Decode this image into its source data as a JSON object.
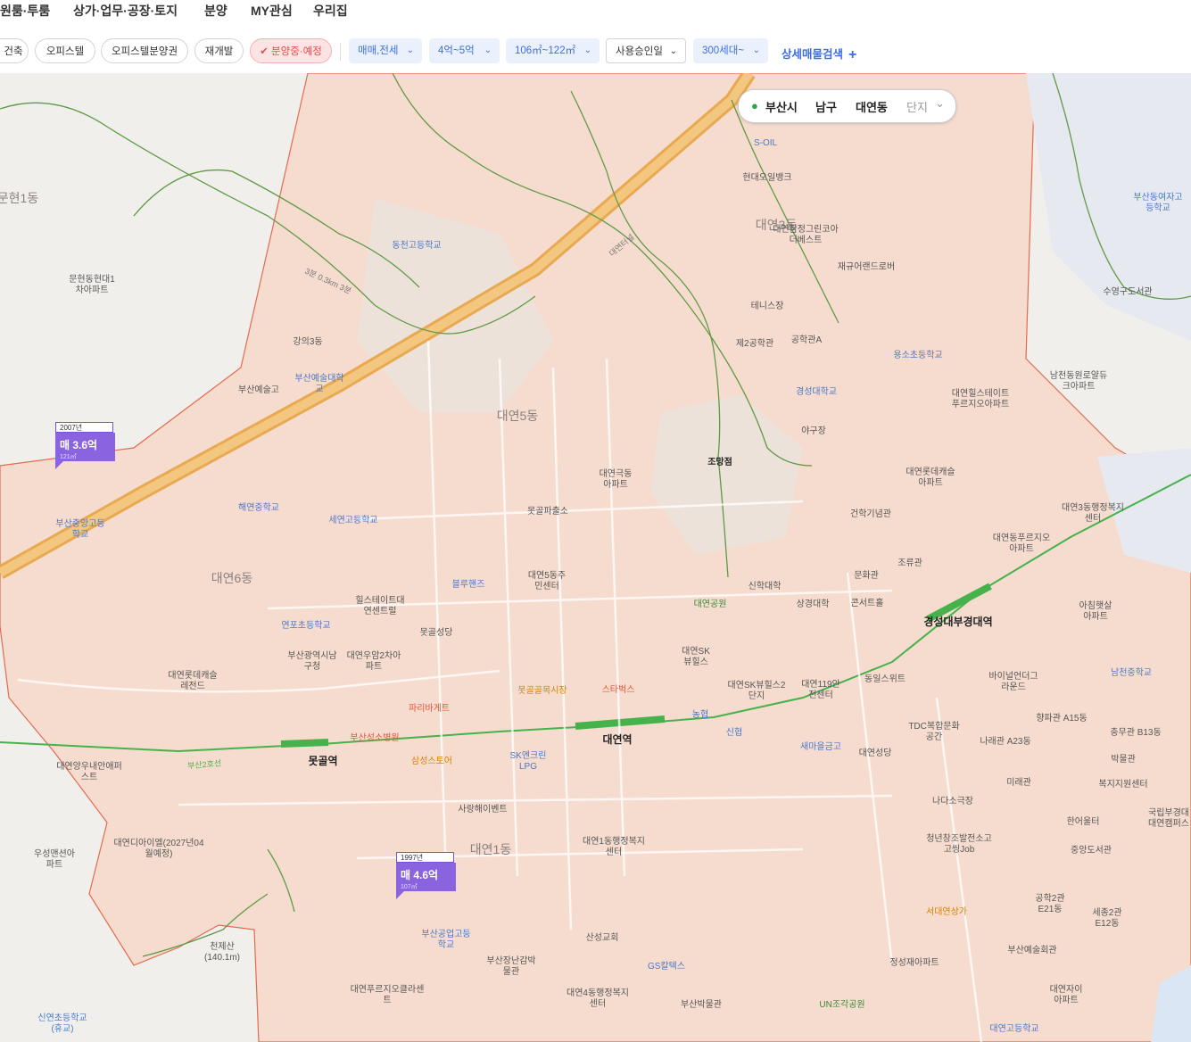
{
  "topnav": [
    "원룸·투룸",
    "상가·업무·공장·토지",
    "분양",
    "MY관심",
    "우리집"
  ],
  "filters": {
    "chips": [
      {
        "label": "건축",
        "active": false
      },
      {
        "label": "오피스텔",
        "active": false
      },
      {
        "label": "오피스텔분양권",
        "active": false
      },
      {
        "label": "재개발",
        "active": false
      },
      {
        "label": "✔ 분양중·예정",
        "active": true
      }
    ],
    "dropdowns": [
      {
        "label": "매매,전세",
        "style": "blue"
      },
      {
        "label": "4억~5억",
        "style": "blue"
      },
      {
        "label": "106㎡~122㎡",
        "style": "blue"
      },
      {
        "label": "사용승인일",
        "style": "white"
      },
      {
        "label": "300세대~",
        "style": "blue"
      }
    ],
    "detail_search": "상세매물검색",
    "plus": "+"
  },
  "location": {
    "city": "부산시",
    "district": "남구",
    "dong": "대연동",
    "type": "단지"
  },
  "icons": {
    "pin": "location-pin-icon",
    "chevron": "chevron-down-icon"
  },
  "colors": {
    "district_fill": "#f6dccf",
    "district_border": "#e46a4e",
    "trail": "#4f8f3a",
    "expressway": "#e9a950",
    "subway": "#46b24b",
    "card": "#8a63e0",
    "active_chip": "#e5504a",
    "dropdown_text": "#3d6fdc"
  },
  "listings": [
    {
      "year": "2007년",
      "price": "매 3.6억",
      "size": "121㎡"
    },
    {
      "year": "1997년",
      "price": "매 4.6억",
      "size": "107㎡"
    }
  ],
  "stations": [
    "못골역",
    "대연역",
    "경성대부경대역"
  ],
  "areas": [
    "문현1동",
    "대연3동",
    "대연5동",
    "대연6동",
    "대연1동"
  ],
  "roads": [
    "대연터널",
    "부산2호선",
    "3분 0.3km 3분"
  ],
  "place_labels": {
    "schools": [
      "동천고등학교",
      "부산중앙고등학교",
      "부산예술대학교",
      "부산예술고",
      "해연중학교",
      "세연고등학교",
      "연포초등학교",
      "용소초등학교",
      "경성대학교",
      "부산동여자고등학교",
      "부산공업고등학교",
      "신연초등학교(휴교)",
      "대연고등학교",
      "남천중학교",
      "국립부경대대연캠퍼스"
    ],
    "apartments": [
      "문현동현대1차아파트",
      "대연극동아파트",
      "대연롯데캐슬아파트",
      "대연힐스테이트푸르지오아파트",
      "대연동푸르지오아파트",
      "힐스테이트대연센트럴",
      "대연롯데캐슬레전드",
      "대연SK뷰힐스",
      "대연SK뷰힐스2단지",
      "대연우암2차아파트",
      "대연양우내안애퍼스트",
      "대연디아이엘(2027년04월예정)",
      "우성맨션아파트",
      "정성재아파트",
      "대연자이아파트",
      "아침햇살아파트",
      "남천동원로얄듀크아파트",
      "대연푸르지오클라센트",
      "동일스위트"
    ],
    "public": [
      "못골파출소",
      "대연5동주민센터",
      "대연1동행정복지센터",
      "대연4동행정복지센터",
      "대연3동행정복지센터",
      "부산광역시남구청",
      "대연119안전센터",
      "부산박물관",
      "부산예술회관",
      "서대연상가",
      "부산장난감박물관"
    ],
    "landmarks": [
      "조망점",
      "천제산(140.1m)",
      "UN조각공원",
      "대연공원",
      "블루핸즈",
      "못골성당",
      "대연성당",
      "산성교회",
      "못골골목시장",
      "삼성스토어",
      "스타벅스",
      "파리바게트",
      "신협",
      "농협",
      "새마을금고",
      "GS칼텍스",
      "S-OIL",
      "SK엔크린LPG",
      "현대오일뱅크",
      "사랑해이벤트",
      "청년창조발전소고고씽Job",
      "나다소극장",
      "TDC복합문화공간",
      "바이널언더그라운드",
      "테니스장",
      "제2공학관",
      "공학관A",
      "야구장",
      "건학기념관",
      "문화관",
      "조류관",
      "콘서트홀",
      "신학대학",
      "상경대학",
      "대연참정그린코아더베스트",
      "재규어랜드로버",
      "향파관 A15동",
      "충무관 B13동",
      "나래관 A23동",
      "미래관",
      "박물관",
      "복지지원센터",
      "한어울터",
      "중앙도서관",
      "공학2관 E21동",
      "세종2관 E12동",
      "수영구도서관",
      "부산성소병원",
      "강의3동"
    ]
  }
}
